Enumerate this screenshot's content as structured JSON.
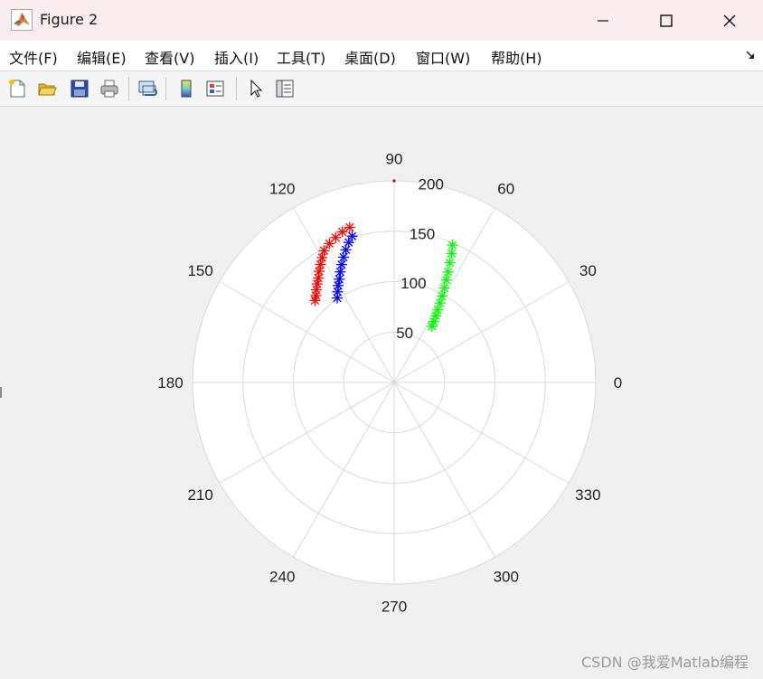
{
  "window": {
    "title": "Figure 2",
    "minimize_icon": "minimize-icon",
    "maximize_icon": "maximize-icon",
    "close_icon": "close-icon"
  },
  "menu": {
    "items": [
      {
        "label": "文件(F)"
      },
      {
        "label": "编辑(E)"
      },
      {
        "label": "查看(V)"
      },
      {
        "label": "插入(I)"
      },
      {
        "label": "工具(T)"
      },
      {
        "label": "桌面(D)"
      },
      {
        "label": "窗口(W)"
      },
      {
        "label": "帮助(H)"
      }
    ]
  },
  "toolbar": {
    "icons": [
      "new-figure-icon",
      "open-file-icon",
      "save-icon",
      "print-icon",
      "link-plot-icon",
      "colorbar-icon",
      "legend-icon",
      "pointer-icon",
      "property-inspector-icon"
    ]
  },
  "watermark": "CSDN @我爱Matlab编程",
  "colors": {
    "red": "#ff0000",
    "blue": "#0000ff",
    "green": "#00ff00",
    "grid": "#d9d9d9"
  },
  "chart_data": {
    "type": "scatter",
    "polar": true,
    "rlim": [
      0,
      200
    ],
    "r_ticks": [
      50,
      100,
      150,
      200
    ],
    "theta_ticks": [
      0,
      30,
      60,
      90,
      120,
      150,
      180,
      210,
      240,
      270,
      300,
      330
    ],
    "marker": "*",
    "grid": true,
    "series": [
      {
        "color": "red",
        "points": [
          {
            "theta": 134,
            "r": 113
          },
          {
            "theta": 132,
            "r": 116
          },
          {
            "theta": 130,
            "r": 120
          },
          {
            "theta": 128,
            "r": 124
          },
          {
            "theta": 126,
            "r": 128
          },
          {
            "theta": 124,
            "r": 133
          },
          {
            "theta": 122,
            "r": 138
          },
          {
            "theta": 120,
            "r": 143
          },
          {
            "theta": 118,
            "r": 148
          },
          {
            "theta": 115,
            "r": 152
          },
          {
            "theta": 112,
            "r": 155
          },
          {
            "theta": 109,
            "r": 158
          },
          {
            "theta": 106,
            "r": 160
          }
        ]
      },
      {
        "color": "blue",
        "points": [
          {
            "theta": 124,
            "r": 101
          },
          {
            "theta": 122,
            "r": 106
          },
          {
            "theta": 120,
            "r": 111
          },
          {
            "theta": 118,
            "r": 116
          },
          {
            "theta": 116,
            "r": 122
          },
          {
            "theta": 114,
            "r": 128
          },
          {
            "theta": 112,
            "r": 134
          },
          {
            "theta": 110,
            "r": 140
          },
          {
            "theta": 108,
            "r": 146
          },
          {
            "theta": 106,
            "r": 151
          }
        ]
      },
      {
        "color": "green",
        "points": [
          {
            "theta": 67,
            "r": 148
          },
          {
            "theta": 66,
            "r": 140
          },
          {
            "theta": 65,
            "r": 131
          },
          {
            "theta": 64,
            "r": 122
          },
          {
            "theta": 63,
            "r": 114
          },
          {
            "theta": 62,
            "r": 106
          },
          {
            "theta": 61,
            "r": 98
          },
          {
            "theta": 60,
            "r": 91
          },
          {
            "theta": 59,
            "r": 84
          },
          {
            "theta": 58,
            "r": 78
          },
          {
            "theta": 57,
            "r": 72
          },
          {
            "theta": 56,
            "r": 67
          }
        ]
      }
    ]
  }
}
